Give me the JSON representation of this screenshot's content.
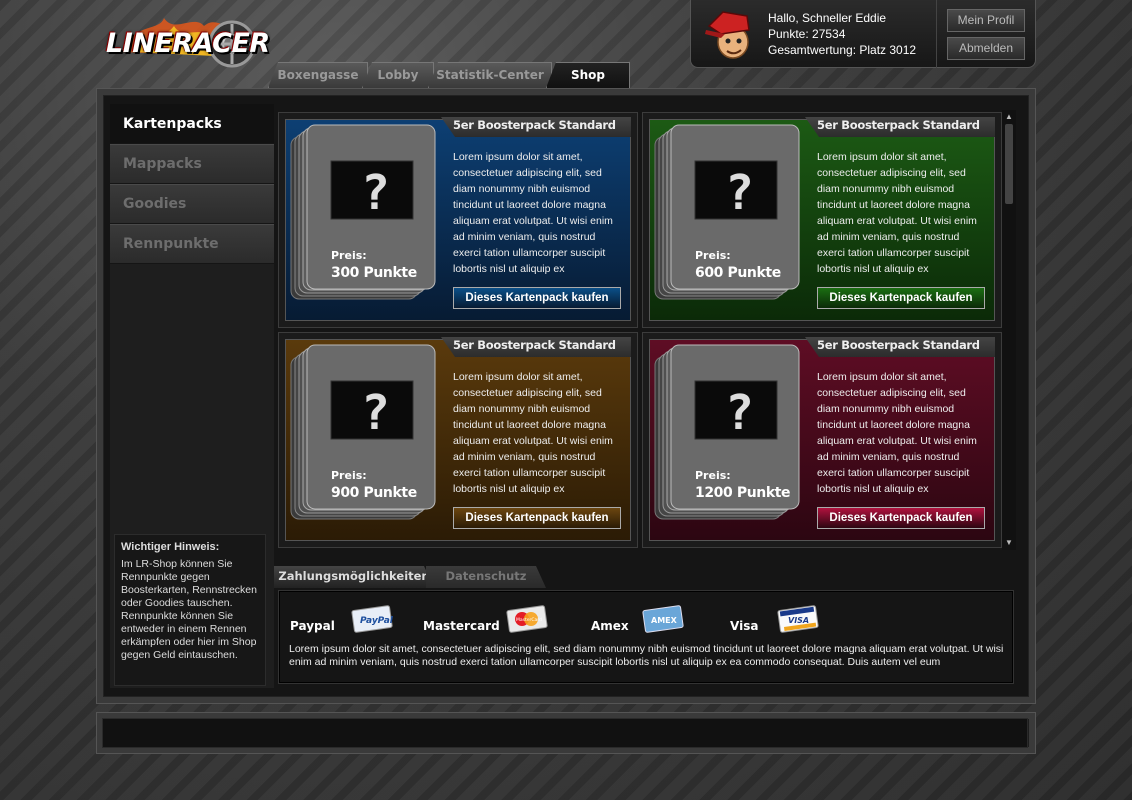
{
  "app": {
    "logo_text": "LINERACER"
  },
  "user": {
    "greeting": "Hallo, Schneller Eddie",
    "points": "Punkte: 27534",
    "ranking": "Gesamtwertung: Platz 3012",
    "profile_button": "Mein Profil",
    "logout_button": "Abmelden"
  },
  "nav": {
    "tabs": [
      {
        "label": "Boxengasse"
      },
      {
        "label": "Lobby"
      },
      {
        "label": "Statistik-Center"
      },
      {
        "label": "Shop"
      }
    ],
    "active": "Shop"
  },
  "sidebar": {
    "items": [
      {
        "label": "Kartenpacks"
      },
      {
        "label": "Mappacks"
      },
      {
        "label": "Goodies"
      },
      {
        "label": "Rennpunkte"
      }
    ],
    "active": "Kartenpacks",
    "notice": {
      "title": "Wichtiger Hinweis:",
      "text": "Im LR-Shop können Sie Rennpunkte gegen Boosterkarten, Rennstrecken oder Goodies tauschen. Rennpunkte können Sie entweder in einem Rennen erkämpfen oder hier im Shop gegen Geld eintauschen."
    }
  },
  "packs": [
    {
      "title": "5er Boosterpack Standard",
      "description": "Lorem ipsum dolor sit amet, consectetuer adipiscing elit, sed diam nonummy nibh euismod tincidunt ut laoreet dolore magna aliquam erat volutpat. Ut wisi enim ad minim veniam, quis nostrud exerci tation ullamcorper suscipit lobortis nisl ut aliquip ex",
      "price_label": "Preis:",
      "price": "300 Punkte",
      "button": "Dieses Kartenpack kaufen",
      "color": "#0d3f73",
      "color_dark": "#071b33",
      "button_color": "#0a4f88"
    },
    {
      "title": "5er Boosterpack Standard",
      "description": "Lorem ipsum dolor sit amet, consectetuer adipiscing elit, sed diam nonummy nibh euismod tincidunt ut laoreet dolore magna aliquam erat volutpat. Ut wisi enim ad minim veniam, quis nostrud exerci tation ullamcorper suscipit lobortis nisl ut aliquip ex",
      "price_label": "Preis:",
      "price": "600 Punkte",
      "button": "Dieses Kartenpack kaufen",
      "color": "#1c5a14",
      "color_dark": "#0b2a08",
      "button_color": "#1b6e12"
    },
    {
      "title": "5er Boosterpack Standard",
      "description": "Lorem ipsum dolor sit amet, consectetuer adipiscing elit, sed diam nonummy nibh euismod tincidunt ut laoreet dolore magna aliquam erat volutpat. Ut wisi enim ad minim veniam, quis nostrud exerci tation ullamcorper suscipit lobortis nisl ut aliquip ex",
      "price_label": "Preis:",
      "price": "900 Punkte",
      "button": "Dieses Kartenpack kaufen",
      "color": "#5a3a0c",
      "color_dark": "#2b1b05",
      "button_color": "#6b4610"
    },
    {
      "title": "5er Boosterpack Standard",
      "description": "Lorem ipsum dolor sit amet, consectetuer adipiscing elit, sed diam nonummy nibh euismod tincidunt ut laoreet dolore magna aliquam erat volutpat. Ut wisi enim ad minim veniam, quis nostrud exerci tation ullamcorper suscipit lobortis nisl ut aliquip ex",
      "price_label": "Preis:",
      "price": "1200 Punkte",
      "button": "Dieses Kartenpack kaufen",
      "color": "#5e0d24",
      "color_dark": "#2c0611",
      "button_color": "#b0123e"
    }
  ],
  "payment": {
    "tabs": [
      {
        "label": "Zahlungsmöglichkeiten"
      },
      {
        "label": "Datenschutz"
      }
    ],
    "active": "Zahlungsmöglichkeiten",
    "methods": [
      {
        "label": "Paypal",
        "icon": "paypal-card-icon"
      },
      {
        "label": "Mastercard",
        "icon": "mastercard-card-icon"
      },
      {
        "label": "Amex",
        "icon": "amex-card-icon"
      },
      {
        "label": "Visa",
        "icon": "visa-card-icon"
      }
    ],
    "card_texts": {
      "paypal": "PayPal",
      "mastercard": "MasterCard",
      "amex": "AMEX",
      "visa": "VISA"
    },
    "text": "Lorem ipsum dolor sit amet, consectetuer adipiscing elit, sed diam nonummy nibh euismod tincidunt ut laoreet dolore magna aliquam erat volutpat. Ut wisi enim ad minim veniam, quis nostrud exerci tation ullamcorper suscipit lobortis nisl ut aliquip ex ea commodo consequat. Duis autem vel eum"
  }
}
